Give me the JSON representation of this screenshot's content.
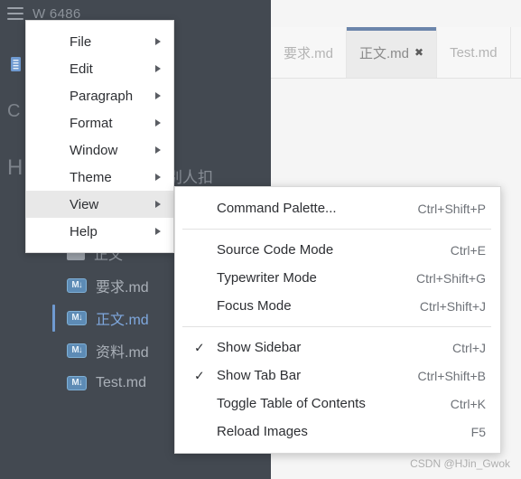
{
  "window": {
    "title": "W 6486",
    "menu_icon": "hamburger-icon"
  },
  "sidebar": {
    "tree_icon": "file-tree-icon",
    "background_glyphs": [
      "C",
      "H",
      "别人扣"
    ],
    "files": [
      {
        "name": "正文",
        "icon": "folder-icon",
        "type": "folder",
        "selected": false
      },
      {
        "name": "要求.md",
        "icon": "markdown-icon",
        "type": "file",
        "selected": false
      },
      {
        "name": "正文.md",
        "icon": "markdown-icon",
        "type": "file",
        "selected": true
      },
      {
        "name": "资料.md",
        "icon": "markdown-icon",
        "type": "file",
        "selected": false
      },
      {
        "name": "Test.md",
        "icon": "markdown-icon",
        "type": "file",
        "selected": false
      }
    ],
    "md_icon_label": "M↓"
  },
  "tabs": [
    {
      "label": "要求.md",
      "active": false,
      "close": ""
    },
    {
      "label": "正文.md",
      "active": true,
      "close": "✖"
    },
    {
      "label": "Test.md",
      "active": false,
      "close": ""
    }
  ],
  "menu": {
    "items": [
      {
        "label": "File",
        "arrow": true,
        "highlight": false
      },
      {
        "label": "Edit",
        "arrow": true,
        "highlight": false
      },
      {
        "label": "Paragraph",
        "arrow": true,
        "highlight": false
      },
      {
        "label": "Format",
        "arrow": true,
        "highlight": false
      },
      {
        "label": "Window",
        "arrow": true,
        "highlight": false
      },
      {
        "label": "Theme",
        "arrow": true,
        "highlight": false
      },
      {
        "label": "View",
        "arrow": true,
        "highlight": true
      },
      {
        "label": "Help",
        "arrow": true,
        "highlight": false
      }
    ]
  },
  "submenu": {
    "items": [
      {
        "label": "Command Palette...",
        "shortcut": "Ctrl+Shift+P",
        "checked": false
      },
      {
        "divider": true
      },
      {
        "label": "Source Code Mode",
        "shortcut": "Ctrl+E",
        "checked": false
      },
      {
        "label": "Typewriter Mode",
        "shortcut": "Ctrl+Shift+G",
        "checked": false
      },
      {
        "label": "Focus Mode",
        "shortcut": "Ctrl+Shift+J",
        "checked": false
      },
      {
        "divider": true
      },
      {
        "label": "Show Sidebar",
        "shortcut": "Ctrl+J",
        "checked": true
      },
      {
        "label": "Show Tab Bar",
        "shortcut": "Ctrl+Shift+B",
        "checked": true
      },
      {
        "label": "Toggle Table of Contents",
        "shortcut": "Ctrl+K",
        "checked": false
      },
      {
        "label": "Reload Images",
        "shortcut": "F5",
        "checked": false
      }
    ],
    "check_glyph": "✓"
  },
  "watermark": "CSDN @HJin_Gwok",
  "colors": {
    "sidebar_bg": "#434951",
    "editor_bg": "#f5f5f5",
    "accent_blue": "#6b85ab",
    "selected_file": "#7fa8de",
    "menu_highlight": "#e8e8e8"
  }
}
